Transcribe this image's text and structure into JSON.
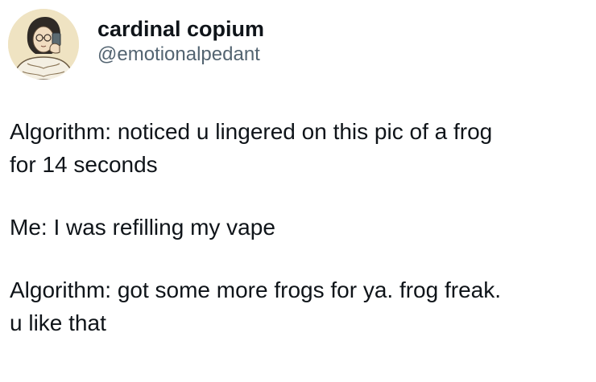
{
  "tweet": {
    "author": {
      "display_name": "cardinal copium",
      "handle": "@emotionalpedant",
      "avatar_icon": "avatar-illustration"
    },
    "text": {
      "paragraphs": [
        "Algorithm: noticed u lingered on this pic of a frog\nfor 14 seconds",
        "Me: I was refilling my vape",
        "Algorithm: got some more frogs for ya. frog freak.\nu like that"
      ]
    }
  },
  "colors": {
    "text_primary": "#0f1419",
    "text_secondary": "#536471",
    "background": "#ffffff"
  }
}
